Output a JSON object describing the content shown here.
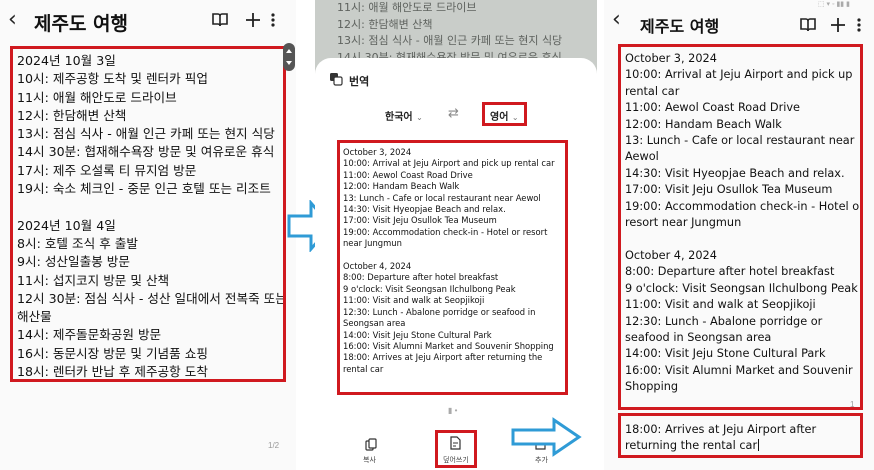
{
  "panel1": {
    "title": "제주도 여행",
    "lines": [
      "2024년 10월 3일",
      "10시: 제주공항 도착 및 렌터카 픽업",
      "11시: 애월 해안도로 드라이브",
      "12시: 한담해변 산책",
      "13시: 점심 식사 - 애월 인근 카페 또는 현지 식당",
      "14시 30분: 협재해수욕장 방문 및 여유로운 휴식",
      "17시: 제주 오설록 티 뮤지엄 방문",
      "19시: 숙소 체크인 - 중문 인근 호텔 또는 리조트",
      "",
      "2024년 10월 4일",
      "8시: 호텔 조식 후 출발",
      "9시: 성산일출봉 방문",
      "11시: 섭지코지 방문 및 산책",
      "12시 30분: 점심 식사 - 성산 일대에서 전복죽 또는",
      "해산물",
      "14시: 제주돌문화공원 방문",
      "16시: 동문시장 방문 및 기념품 쇼핑",
      "18시: 렌터카 반납 후 제주공항 도착"
    ],
    "page_number": "1/2"
  },
  "panel2": {
    "background_lines": [
      "11시: 애월 해안도로 드라이브",
      "12시: 한담해변 산책",
      "13시: 점심 식사 - 애월 인근 카페 또는 현지 식당",
      "14시 30분: 협재해수욕장 방문 및 여유로운 휴식"
    ],
    "sheet_title": "번역",
    "source_language": "한국어",
    "target_language": "영어",
    "translation_lines": [
      "October 3, 2024",
      "10:00: Arrival at Jeju Airport and pick up rental car",
      "11:00: Aewol Coast Road Drive",
      "12:00: Handam Beach Walk",
      "13: Lunch - Cafe or local restaurant near Aewol",
      "14:30: Visit Hyeopjae Beach and relax.",
      "17:00: Visit Jeju Osullok Tea Museum",
      "19:00: Accommodation check-in - Hotel or resort",
      "near Jungmun",
      "",
      "October 4, 2024",
      "8:00: Departure after hotel breakfast",
      "9 o'clock: Visit Seongsan Ilchulbong Peak",
      "11:00: Visit and walk at Seopjikoji",
      "12:30: Lunch - Abalone porridge or seafood in",
      "Seongsan area",
      "14:00: Visit Jeju Stone Cultural Park",
      "16:00: Visit Alumni Market and Souvenir Shopping",
      "18:00: Arrives at Jeju Airport after returning the",
      "rental car"
    ],
    "actions": {
      "copy": "복사",
      "overwrite": "덮어쓰기",
      "add": "추가"
    }
  },
  "panel3": {
    "title": "제주도 여행",
    "lines": [
      "October 3, 2024",
      "10:00: Arrival at Jeju Airport and pick up",
      "rental car",
      "11:00: Aewol Coast Road Drive",
      "12:00: Handam Beach Walk",
      "13: Lunch - Cafe or local restaurant near",
      "Aewol",
      "14:30: Visit Hyeopjae Beach and relax.",
      "17:00: Visit Jeju Osullok Tea Museum",
      "19:00: Accommodation check-in - Hotel or",
      "resort near Jungmun",
      "",
      "October 4, 2024",
      "8:00: Departure after hotel breakfast",
      "9 o'clock: Visit Seongsan Ilchulbong Peak",
      "11:00: Visit and walk at Seopjikoji",
      "12:30: Lunch - Abalone porridge or",
      "seafood in Seongsan area",
      "14:00: Visit Jeju Stone Cultural Park",
      "16:00: Visit Alumni Market and Souvenir",
      "Shopping"
    ],
    "last_lines": [
      "18:00: Arrives at Jeju Airport after",
      "returning the rental car"
    ],
    "page_number": "1"
  },
  "colors": {
    "highlight": "#d0191f",
    "arrow": "#2f9bd6"
  }
}
